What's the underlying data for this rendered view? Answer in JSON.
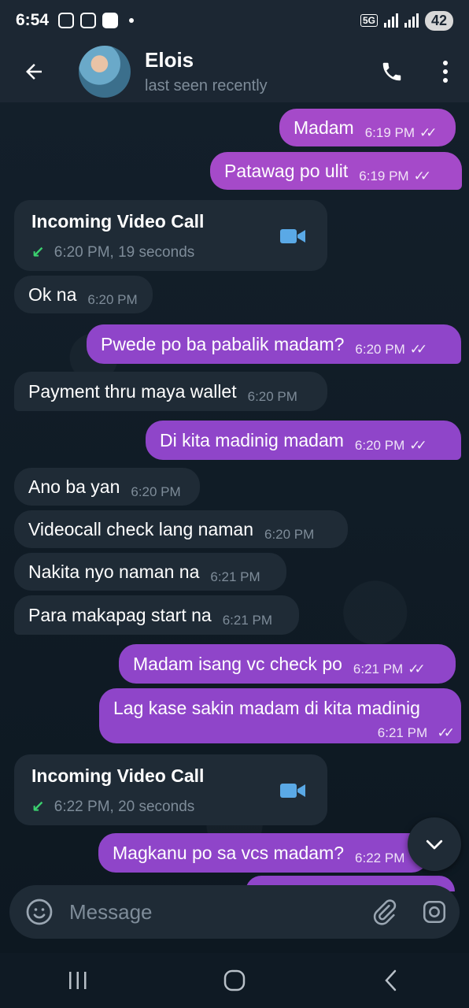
{
  "status_bar": {
    "time": "6:54",
    "network": "5G",
    "battery": "42"
  },
  "header": {
    "contact_name": "Elois",
    "contact_status": "last seen recently"
  },
  "messages": [
    {
      "dir": "out",
      "text": "Madam",
      "time": "6:19 PM",
      "read": true
    },
    {
      "dir": "out",
      "text": "Patawag po ulit",
      "time": "6:19 PM",
      "read": true
    },
    {
      "dir": "call",
      "title": "Incoming Video Call",
      "meta": "6:20 PM, 19 seconds"
    },
    {
      "dir": "in",
      "text": "Ok na",
      "time": "6:20 PM"
    },
    {
      "dir": "out",
      "text": "Pwede po ba pabalik madam?",
      "time": "6:20 PM",
      "read": true
    },
    {
      "dir": "in",
      "text": "Payment thru maya wallet",
      "time": "6:20 PM"
    },
    {
      "dir": "out",
      "text": "Di kita madinig madam",
      "time": "6:20 PM",
      "read": true
    },
    {
      "dir": "in",
      "text": "Ano ba yan",
      "time": "6:20 PM"
    },
    {
      "dir": "in",
      "text": "Videocall check lang naman",
      "time": "6:20 PM"
    },
    {
      "dir": "in",
      "text": "Nakita nyo naman na",
      "time": "6:21 PM"
    },
    {
      "dir": "in",
      "text": "Para makapag start na",
      "time": "6:21 PM"
    },
    {
      "dir": "out",
      "text": "Madam isang vc check po",
      "time": "6:21 PM",
      "read": true
    },
    {
      "dir": "out",
      "text": "Lag kase sakin madam di kita madinig",
      "time": "6:21 PM",
      "read": true
    },
    {
      "dir": "call",
      "title": "Incoming Video Call",
      "meta": "6:22 PM, 20 seconds"
    },
    {
      "dir": "out",
      "text": "Magkanu po sa vcs madam?",
      "time": "6:22 PM",
      "read": true
    }
  ],
  "input": {
    "placeholder": "Message"
  },
  "icons": {
    "back": "arrow-left-icon",
    "call": "phone-icon",
    "more": "more-vert-icon",
    "emoji": "emoji-icon",
    "attach": "paperclip-icon",
    "camera": "instagram-camera-icon",
    "video": "video-camera-icon",
    "scroll": "chevron-down-icon"
  },
  "colors": {
    "outgoing": "#8f45c9",
    "incoming": "#1f2b36",
    "header": "#1c2733",
    "call_arrow": "#3bd16f",
    "video_icon": "#5aa9e6"
  }
}
